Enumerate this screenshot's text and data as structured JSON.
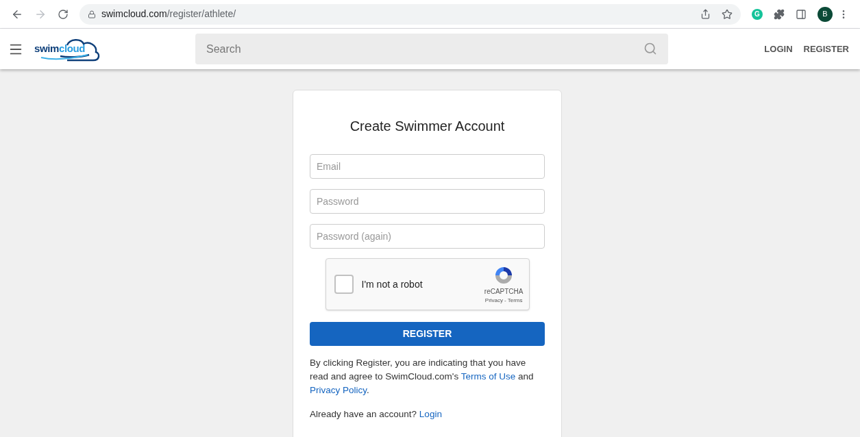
{
  "browser": {
    "url_host": "swimcloud.com",
    "url_path": "/register/athlete/",
    "extension_letter": "G",
    "profile_letter": "B"
  },
  "header": {
    "logo": {
      "part_1": "swim",
      "part_2": "cloud"
    },
    "search": {
      "placeholder": "Search"
    },
    "nav": [
      "LOGIN",
      "REGISTER"
    ]
  },
  "form": {
    "title": "Create Swimmer Account",
    "fields": [
      {
        "placeholder": "Email"
      },
      {
        "placeholder": "Password"
      },
      {
        "placeholder": "Password (again)"
      }
    ],
    "captcha": {
      "label": "I'm not a robot",
      "checked": false,
      "brand": "reCAPTCHA",
      "privacy": "Privacy",
      "separator": "-",
      "terms": "Terms"
    },
    "submit": "REGISTER",
    "notice": {
      "before": "By clicking Register, you are indicating that you have read and agree to SwimCloud.com's ",
      "terms_link": "Terms of Use",
      "middle": " and ",
      "privacy_link": "Privacy Policy",
      "after": "."
    },
    "login_prompt": {
      "text": "Already have an account? ",
      "link": "Login"
    }
  }
}
